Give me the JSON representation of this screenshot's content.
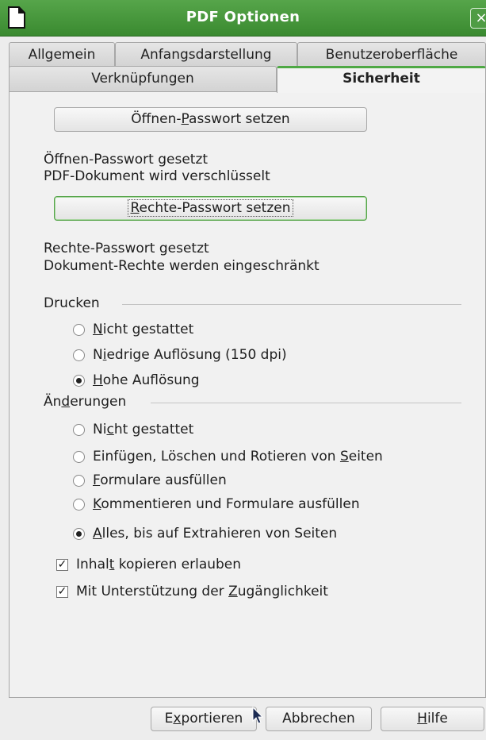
{
  "window": {
    "title": "PDF Optionen",
    "close_glyph": "×",
    "icon": "document-icon",
    "accent_color": "#4ea844"
  },
  "tabs": {
    "row1": [
      {
        "pre": "Allgemein",
        "ul": "",
        "post": ""
      },
      {
        "pre": "Anfangsdarstellung",
        "ul": "",
        "post": ""
      },
      {
        "pre": "Benutzeroberfläche",
        "ul": "",
        "post": ""
      }
    ],
    "row2": [
      {
        "pre": "Verknüpfungen",
        "ul": "",
        "post": ""
      },
      {
        "pre": "Sicherheit",
        "ul": "",
        "post": "",
        "active": true
      }
    ]
  },
  "security": {
    "open_pw_button": {
      "pre": "Öffnen-",
      "ul": "P",
      "post": "asswort setzen"
    },
    "open_pw_status": [
      "Öffnen-Passwort gesetzt",
      "PDF-Dokument wird verschlüsselt"
    ],
    "rights_pw_button": {
      "pre": "",
      "ul": "R",
      "post": "echte-Passwort setzen"
    },
    "rights_pw_status": [
      "Rechte-Passwort gesetzt",
      "Dokument-Rechte werden eingeschränkt"
    ]
  },
  "printing": {
    "label": "Drucken",
    "options": [
      {
        "pre": "",
        "ul": "N",
        "post": "icht gestattet",
        "selected": false
      },
      {
        "pre": "N",
        "ul": "i",
        "post": "edrige Auflösung (150 dpi)",
        "selected": false
      },
      {
        "pre": "",
        "ul": "H",
        "post": "ohe Auflösung",
        "selected": true
      }
    ]
  },
  "changes": {
    "label": {
      "pre": "Än",
      "ul": "d",
      "post": "erungen"
    },
    "options": [
      {
        "pre": "Ni",
        "ul": "c",
        "post": "ht gestattet",
        "selected": false
      },
      {
        "pre": "Einfügen, Löschen und Rotieren von ",
        "ul": "S",
        "post": "eiten",
        "selected": false
      },
      {
        "pre": "",
        "ul": "F",
        "post": "ormulare ausfüllen",
        "selected": false
      },
      {
        "pre": "",
        "ul": "K",
        "post": "ommentieren und Formulare ausfüllen",
        "selected": false
      },
      {
        "pre": "",
        "ul": "A",
        "post": "lles, bis auf Extrahieren von Seiten",
        "selected": true
      }
    ]
  },
  "checkboxes": [
    {
      "pre": "Inhal",
      "ul": "t",
      "post": " kopieren erlauben",
      "checked": true,
      "glyph": "✓"
    },
    {
      "pre": "Mit Unterstützung der ",
      "ul": "Z",
      "post": "ugänglichkeit",
      "checked": true,
      "glyph": "✓"
    }
  ],
  "footer": {
    "export": {
      "pre": "E",
      "ul": "x",
      "post": "portieren"
    },
    "cancel": {
      "pre": "Abbrechen",
      "ul": "",
      "post": ""
    },
    "help": {
      "pre": "",
      "ul": "H",
      "post": "ilfe"
    }
  }
}
